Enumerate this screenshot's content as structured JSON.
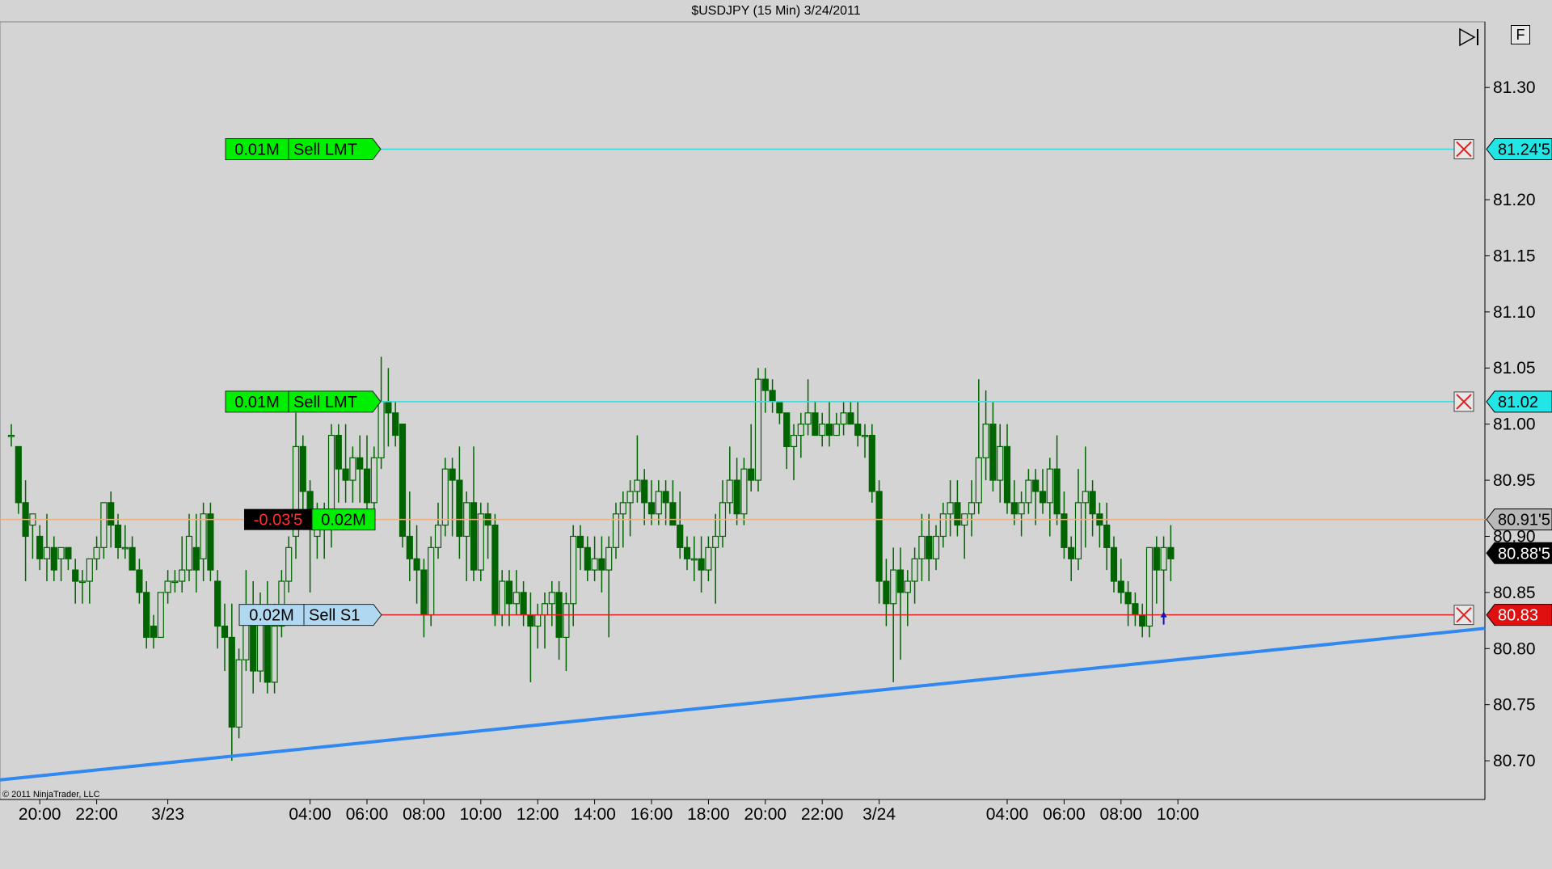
{
  "title": "$USDJPY (15 Min)  3/24/2011",
  "copyright": "© 2011 NinjaTrader, LLC",
  "toolbar": {
    "f_label": "F",
    "scroll_end_icon": "scroll-to-end-icon"
  },
  "colors": {
    "background": "#d4d4d4",
    "candle": "#006400",
    "limit_line": "#33dddd",
    "stop_line": "#e02020",
    "position_line": "#e8b080",
    "trend_line": "#3088f0",
    "order_green": "#00ee00",
    "stop_tag": "#b0d8f0"
  },
  "chart_data": {
    "type": "candlestick",
    "symbol": "$USDJPY",
    "interval": "15 Min",
    "date": "3/24/2011",
    "y_ticks": [
      "81.30",
      "81.20",
      "81.15",
      "81.10",
      "81.05",
      "81.00",
      "80.95",
      "80.90",
      "80.85",
      "80.80",
      "80.75",
      "80.70"
    ],
    "y_range": [
      80.6655,
      81.3585
    ],
    "x_ticks": [
      "20:00",
      "22:00",
      "3/23",
      "04:00",
      "06:00",
      "08:00",
      "10:00",
      "12:00",
      "14:00",
      "16:00",
      "18:00",
      "20:00",
      "22:00",
      "3/24",
      "04:00",
      "06:00",
      "08:00",
      "10:00"
    ],
    "orders": [
      {
        "qty": "0.01M",
        "label": "Sell LMT",
        "price": "81.24'5",
        "price_value": 81.245,
        "type": "limit"
      },
      {
        "qty": "0.01M",
        "label": "Sell LMT",
        "price": "81.02",
        "price_value": 81.02,
        "type": "limit"
      },
      {
        "qty": "0.02M",
        "label": "Sell S1",
        "price": "80.83",
        "price_value": 80.83,
        "type": "stop"
      }
    ],
    "position": {
      "pnl": "-0.03'5",
      "qty": "0.02M",
      "price": "80.91'5",
      "price_value": 80.915
    },
    "last_price": {
      "label": "80.88'5",
      "value": 80.885
    },
    "trend_line": {
      "start": {
        "time": "3/22 18:45",
        "price": 80.683
      },
      "end": {
        "time": "3/24 10:45",
        "price": 80.818
      }
    },
    "candles": [
      [
        80.99,
        81.0,
        80.98,
        80.99
      ],
      [
        80.98,
        80.98,
        80.92,
        80.93
      ],
      [
        80.93,
        80.95,
        80.86,
        80.9
      ],
      [
        80.91,
        80.92,
        80.88,
        80.92
      ],
      [
        80.9,
        80.91,
        80.87,
        80.88
      ],
      [
        80.88,
        80.92,
        80.86,
        80.89
      ],
      [
        80.89,
        80.9,
        80.86,
        80.87
      ],
      [
        80.88,
        80.89,
        80.86,
        80.89
      ],
      [
        80.89,
        80.89,
        80.87,
        80.88
      ],
      [
        80.87,
        80.88,
        80.84,
        80.86
      ],
      [
        80.86,
        80.87,
        80.84,
        80.86
      ],
      [
        80.86,
        80.88,
        80.84,
        80.88
      ],
      [
        80.88,
        80.9,
        80.87,
        80.89
      ],
      [
        80.89,
        80.93,
        80.88,
        80.93
      ],
      [
        80.93,
        80.94,
        80.89,
        80.91
      ],
      [
        80.91,
        80.92,
        80.88,
        80.89
      ],
      [
        80.89,
        80.91,
        80.88,
        80.89
      ],
      [
        80.89,
        80.9,
        80.87,
        80.87
      ],
      [
        80.87,
        80.88,
        80.84,
        80.85
      ],
      [
        80.85,
        80.86,
        80.8,
        80.81
      ],
      [
        80.82,
        80.83,
        80.8,
        80.81
      ],
      [
        80.81,
        80.85,
        80.81,
        80.85
      ],
      [
        80.85,
        80.87,
        80.84,
        80.86
      ],
      [
        80.86,
        80.87,
        80.85,
        80.86
      ],
      [
        80.86,
        80.9,
        80.85,
        80.87
      ],
      [
        80.87,
        80.92,
        80.86,
        80.9
      ],
      [
        80.89,
        80.92,
        80.85,
        80.87
      ],
      [
        80.88,
        80.93,
        80.86,
        80.92
      ],
      [
        80.92,
        80.93,
        80.86,
        80.87
      ],
      [
        80.86,
        80.87,
        80.8,
        80.82
      ],
      [
        80.82,
        80.84,
        80.78,
        80.81
      ],
      [
        80.81,
        80.84,
        80.7,
        80.73
      ],
      [
        80.73,
        80.8,
        80.72,
        80.79
      ],
      [
        80.79,
        80.87,
        80.78,
        80.83
      ],
      [
        80.83,
        80.86,
        80.76,
        80.78
      ],
      [
        80.78,
        80.85,
        80.77,
        80.83
      ],
      [
        80.83,
        80.86,
        80.76,
        80.77
      ],
      [
        80.77,
        80.84,
        80.76,
        80.82
      ],
      [
        80.82,
        80.87,
        80.81,
        80.86
      ],
      [
        80.86,
        80.9,
        80.85,
        80.89
      ],
      [
        80.9,
        81.01,
        80.88,
        80.98
      ],
      [
        80.98,
        80.99,
        80.92,
        80.94
      ],
      [
        80.94,
        80.95,
        80.85,
        80.91
      ],
      [
        80.9,
        80.93,
        80.88,
        80.91
      ],
      [
        80.91,
        80.93,
        80.88,
        80.92
      ],
      [
        80.92,
        81.0,
        80.89,
        80.99
      ],
      [
        80.99,
        81.0,
        80.93,
        80.96
      ],
      [
        80.96,
        81.0,
        80.93,
        80.95
      ],
      [
        80.95,
        80.98,
        80.93,
        80.97
      ],
      [
        80.97,
        80.99,
        80.93,
        80.96
      ],
      [
        80.96,
        80.99,
        80.92,
        80.93
      ],
      [
        80.93,
        80.98,
        80.92,
        80.97
      ],
      [
        80.97,
        81.06,
        80.96,
        81.02
      ],
      [
        81.02,
        81.05,
        80.98,
        81.01
      ],
      [
        81.01,
        81.02,
        80.98,
        80.99
      ],
      [
        81.0,
        81.0,
        80.89,
        80.9
      ],
      [
        80.9,
        80.94,
        80.86,
        80.88
      ],
      [
        80.88,
        80.91,
        80.84,
        80.87
      ],
      [
        80.87,
        80.88,
        80.81,
        80.83
      ],
      [
        80.83,
        80.9,
        80.82,
        80.89
      ],
      [
        80.89,
        80.93,
        80.88,
        80.91
      ],
      [
        80.91,
        80.97,
        80.9,
        80.96
      ],
      [
        80.96,
        80.97,
        80.9,
        80.95
      ],
      [
        80.95,
        80.98,
        80.88,
        80.9
      ],
      [
        80.9,
        80.94,
        80.86,
        80.93
      ],
      [
        80.93,
        80.98,
        80.86,
        80.87
      ],
      [
        80.87,
        80.93,
        80.86,
        80.92
      ],
      [
        80.92,
        80.93,
        80.88,
        80.91
      ],
      [
        80.91,
        80.92,
        80.82,
        80.83
      ],
      [
        80.83,
        80.87,
        80.82,
        80.86
      ],
      [
        80.86,
        80.87,
        80.82,
        80.84
      ],
      [
        80.84,
        80.87,
        80.83,
        80.85
      ],
      [
        80.85,
        80.86,
        80.82,
        80.83
      ],
      [
        80.83,
        80.85,
        80.77,
        80.82
      ],
      [
        80.82,
        80.84,
        80.8,
        80.83
      ],
      [
        80.83,
        80.85,
        80.8,
        80.84
      ],
      [
        80.84,
        80.86,
        80.82,
        80.85
      ],
      [
        80.85,
        80.86,
        80.79,
        80.81
      ],
      [
        80.81,
        80.85,
        80.78,
        80.84
      ],
      [
        80.84,
        80.91,
        80.82,
        80.9
      ],
      [
        80.9,
        80.91,
        80.87,
        80.89
      ],
      [
        80.89,
        80.9,
        80.86,
        80.87
      ],
      [
        80.87,
        80.9,
        80.86,
        80.88
      ],
      [
        80.88,
        80.9,
        80.85,
        80.87
      ],
      [
        80.87,
        80.9,
        80.81,
        80.89
      ],
      [
        80.89,
        80.93,
        80.88,
        80.92
      ],
      [
        80.92,
        80.94,
        80.89,
        80.93
      ],
      [
        80.93,
        80.95,
        80.9,
        80.94
      ],
      [
        80.94,
        80.99,
        80.93,
        80.95
      ],
      [
        80.95,
        80.96,
        80.91,
        80.93
      ],
      [
        80.93,
        80.95,
        80.91,
        80.92
      ],
      [
        80.92,
        80.95,
        80.91,
        80.94
      ],
      [
        80.94,
        80.95,
        80.91,
        80.93
      ],
      [
        80.93,
        80.95,
        80.91,
        80.91
      ],
      [
        80.91,
        80.94,
        80.88,
        80.89
      ],
      [
        80.89,
        80.9,
        80.87,
        80.88
      ],
      [
        80.88,
        80.9,
        80.86,
        80.88
      ],
      [
        80.88,
        80.9,
        80.85,
        80.87
      ],
      [
        80.87,
        80.9,
        80.86,
        80.89
      ],
      [
        80.89,
        80.92,
        80.84,
        80.9
      ],
      [
        80.9,
        80.95,
        80.89,
        80.93
      ],
      [
        80.93,
        80.98,
        80.92,
        80.95
      ],
      [
        80.95,
        80.97,
        80.91,
        80.92
      ],
      [
        80.92,
        80.97,
        80.91,
        80.96
      ],
      [
        80.96,
        81.0,
        80.94,
        80.95
      ],
      [
        80.95,
        81.05,
        80.94,
        81.04
      ],
      [
        81.04,
        81.05,
        81.01,
        81.03
      ],
      [
        81.03,
        81.04,
        81.01,
        81.02
      ],
      [
        81.02,
        81.02,
        81.0,
        81.01
      ],
      [
        81.01,
        81.01,
        80.96,
        80.98
      ],
      [
        80.98,
        81.0,
        80.95,
        80.99
      ],
      [
        80.99,
        81.01,
        80.97,
        81.0
      ],
      [
        81.0,
        81.04,
        80.99,
        81.01
      ],
      [
        81.01,
        81.02,
        80.99,
        80.99
      ],
      [
        80.99,
        81.01,
        80.98,
        81.0
      ],
      [
        81.0,
        81.02,
        80.98,
        80.99
      ],
      [
        80.99,
        81.01,
        80.99,
        81.0
      ],
      [
        81.0,
        81.02,
        80.99,
        81.01
      ],
      [
        81.01,
        81.02,
        81.0,
        81.0
      ],
      [
        81.0,
        81.02,
        80.98,
        80.99
      ],
      [
        80.99,
        81.0,
        80.97,
        80.99
      ],
      [
        80.99,
        81.0,
        80.93,
        80.94
      ],
      [
        80.94,
        80.95,
        80.84,
        80.86
      ],
      [
        80.86,
        80.88,
        80.82,
        80.84
      ],
      [
        80.84,
        80.89,
        80.77,
        80.87
      ],
      [
        80.87,
        80.89,
        80.79,
        80.85
      ],
      [
        80.85,
        80.87,
        80.82,
        80.86
      ],
      [
        80.86,
        80.89,
        80.84,
        80.88
      ],
      [
        80.88,
        80.92,
        80.86,
        80.9
      ],
      [
        80.9,
        80.92,
        80.86,
        80.88
      ],
      [
        80.88,
        80.91,
        80.87,
        80.9
      ],
      [
        80.9,
        80.93,
        80.89,
        80.92
      ],
      [
        80.92,
        80.95,
        80.9,
        80.93
      ],
      [
        80.93,
        80.95,
        80.9,
        80.91
      ],
      [
        80.91,
        80.92,
        80.88,
        80.92
      ],
      [
        80.92,
        80.95,
        80.9,
        80.93
      ],
      [
        80.93,
        81.04,
        80.92,
        80.97
      ],
      [
        80.97,
        81.03,
        80.95,
        81.0
      ],
      [
        81.0,
        81.02,
        80.94,
        80.95
      ],
      [
        80.95,
        81.0,
        80.93,
        80.98
      ],
      [
        80.98,
        81.0,
        80.92,
        80.93
      ],
      [
        80.93,
        80.95,
        80.91,
        80.92
      ],
      [
        80.92,
        80.94,
        80.9,
        80.93
      ],
      [
        80.93,
        80.96,
        80.92,
        80.95
      ],
      [
        80.95,
        80.96,
        80.91,
        80.94
      ],
      [
        80.94,
        80.96,
        80.92,
        80.93
      ],
      [
        80.93,
        80.97,
        80.9,
        80.96
      ],
      [
        80.96,
        80.99,
        80.91,
        80.92
      ],
      [
        80.92,
        80.94,
        80.88,
        80.89
      ],
      [
        80.89,
        80.9,
        80.86,
        80.88
      ],
      [
        80.88,
        80.96,
        80.87,
        80.93
      ],
      [
        80.93,
        80.98,
        80.89,
        80.94
      ],
      [
        80.94,
        80.95,
        80.9,
        80.92
      ],
      [
        80.92,
        80.93,
        80.89,
        80.91
      ],
      [
        80.91,
        80.93,
        80.87,
        80.89
      ],
      [
        80.89,
        80.9,
        80.85,
        80.86
      ],
      [
        80.86,
        80.88,
        80.84,
        80.85
      ],
      [
        80.85,
        80.86,
        80.82,
        80.84
      ],
      [
        80.84,
        80.85,
        80.82,
        80.83
      ],
      [
        80.83,
        80.84,
        80.81,
        80.82
      ],
      [
        80.82,
        80.89,
        80.81,
        80.89
      ],
      [
        80.89,
        80.9,
        80.84,
        80.87
      ],
      [
        80.87,
        80.9,
        80.83,
        80.89
      ],
      [
        80.89,
        80.91,
        80.86,
        80.88
      ]
    ]
  }
}
